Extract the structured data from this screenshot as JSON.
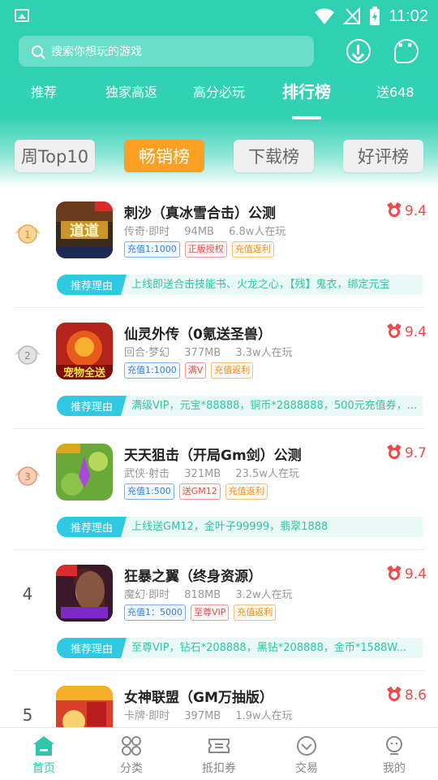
{
  "status_bar": {
    "time": "11:02"
  },
  "search": {
    "placeholder": "搜索你想玩的游戏"
  },
  "nav_tabs": [
    {
      "label": "推荐"
    },
    {
      "label": "独家高返"
    },
    {
      "label": "高分必玩"
    },
    {
      "label": "排行榜",
      "active": true
    },
    {
      "label": "送648"
    }
  ],
  "sub_tabs": [
    {
      "label": "周Top10"
    },
    {
      "label": "畅销榜",
      "active": true
    },
    {
      "label": "下载榜"
    },
    {
      "label": "好评榜"
    }
  ],
  "reason_label": "推荐理由",
  "games": [
    {
      "rank": "1",
      "name": "刺沙（真冰雪合击）公测",
      "genre": "传奇·即时",
      "size": "94MB",
      "players": "6.8w人在玩",
      "score": "9.4",
      "tags": [
        "充值1:1000",
        "正版授权",
        "充值返利"
      ],
      "reason": "上线即送合击技能书、火龙之心，【残】鬼衣，绑定元宝"
    },
    {
      "rank": "2",
      "name": "仙灵外传（0氪送圣兽）",
      "genre": "回合·梦幻",
      "size": "377MB",
      "players": "3.3w人在玩",
      "score": "9.4",
      "tags": [
        "充值1:1000",
        "满V",
        "充值返利"
      ],
      "reason": "满级VIP，元宝*88888，铜币*2888888，500元充值券，..."
    },
    {
      "rank": "3",
      "name": "天天狙击（开局Gm剑）公测",
      "genre": "武侠·射击",
      "size": "321MB",
      "players": "23.5w人在玩",
      "score": "9.7",
      "tags": [
        "充值1:500",
        "送GM12",
        "充值返利"
      ],
      "reason": "上线送GM12，金叶子99999，翡翠1888"
    },
    {
      "rank": "4",
      "name": "狂暴之翼（终身资源）",
      "genre": "魔幻·即时",
      "size": "818MB",
      "players": "3.2w人在玩",
      "score": "9.4",
      "tags": [
        "充值1：5000",
        "至尊VIP",
        "充值返利"
      ],
      "reason": "至尊VIP，钻石*208888，黑钻*208888，金币*1588W..."
    },
    {
      "rank": "5",
      "name": "女神联盟（GM万抽版）",
      "genre": "卡牌·即时",
      "size": "397MB",
      "players": "1.9w人在玩",
      "score": "8.6",
      "tags": [],
      "reason": ""
    }
  ],
  "bottom_tabs": [
    {
      "label": "首页",
      "icon": "home-icon",
      "active": true
    },
    {
      "label": "分类",
      "icon": "category-icon"
    },
    {
      "label": "抵扣券",
      "icon": "coupon-icon"
    },
    {
      "label": "交易",
      "icon": "trade-icon"
    },
    {
      "label": "我的",
      "icon": "profile-icon"
    }
  ],
  "colors": {
    "accent": "#2fd0b2",
    "active_subtab": "#fba022",
    "score": "#f04a4a",
    "reason_label": "#2fc9e2"
  }
}
